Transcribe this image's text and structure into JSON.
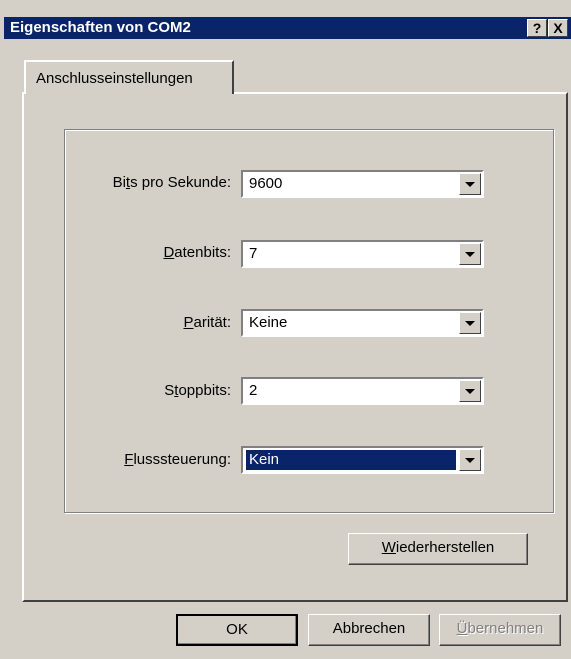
{
  "window": {
    "title": "Eigenschaften von COM2",
    "help_button": "?",
    "close_button": "X"
  },
  "tab": {
    "label": "Anschlusseinstellungen"
  },
  "fields": [
    {
      "label_pre": "Bi",
      "label_key": "t",
      "label_post": "s pro Sekunde:",
      "value": "9600"
    },
    {
      "label_pre": "",
      "label_key": "D",
      "label_post": "atenbits:",
      "value": "7"
    },
    {
      "label_pre": "",
      "label_key": "P",
      "label_post": "arität:",
      "value": "Keine"
    },
    {
      "label_pre": "S",
      "label_key": "t",
      "label_post": "oppbits:",
      "value": "2"
    },
    {
      "label_pre": "",
      "label_key": "F",
      "label_post": "lusssteuerung:",
      "value": "Kein"
    }
  ],
  "restore_button": {
    "label_pre": "",
    "label_key": "W",
    "label_post": "iederherstellen"
  },
  "buttons": {
    "ok": "OK",
    "cancel": "Abbrechen",
    "apply_key": "Ü",
    "apply_post": "bernehmen"
  },
  "colors": {
    "titlebar": "#0a246a",
    "face": "#d4d0c8",
    "selection": "#0a246a"
  }
}
